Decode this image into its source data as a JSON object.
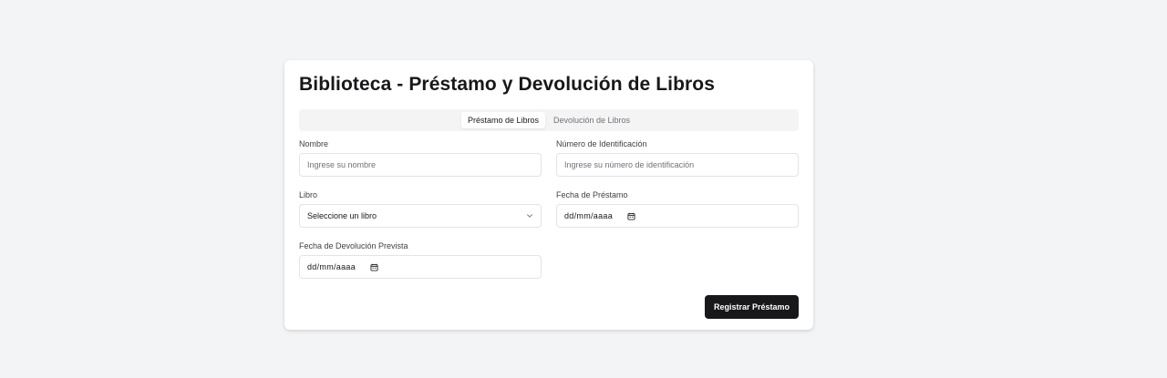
{
  "page": {
    "title": "Biblioteca - Préstamo y Devolución de Libros"
  },
  "tabs": [
    {
      "label": "Préstamo de Libros",
      "active": true
    },
    {
      "label": "Devolución de Libros",
      "active": false
    }
  ],
  "form": {
    "nombre": {
      "label": "Nombre",
      "placeholder": "Ingrese su nombre",
      "value": ""
    },
    "identificacion": {
      "label": "Número de Identificación",
      "placeholder": "Ingrese su número de identificación",
      "value": ""
    },
    "libro": {
      "label": "Libro",
      "selected": "Seleccione un libro"
    },
    "fecha_prestamo": {
      "label": "Fecha de Préstamo",
      "value": "dd/mm/aaaa"
    },
    "fecha_devolucion": {
      "label": "Fecha de Devolución Prevista",
      "value": "dd/mm/aaaa"
    }
  },
  "actions": {
    "submit_label": "Registrar Préstamo"
  },
  "colors": {
    "background": "#f3f4f6",
    "card": "#ffffff",
    "primary_button": "#18181b",
    "tab_track": "#f4f4f5",
    "border": "#e4e4e7"
  },
  "icons": {
    "calendar": "calendar-icon",
    "dropdown": "chevron-down-icon"
  }
}
